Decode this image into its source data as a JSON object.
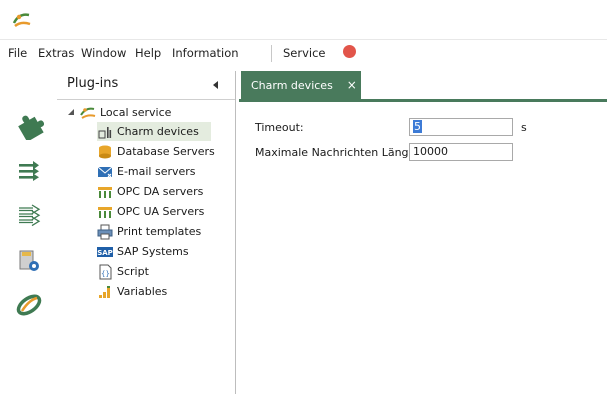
{
  "menubar": {
    "items": [
      "File",
      "Extras",
      "Window",
      "Help",
      "Information",
      "Service"
    ]
  },
  "status_color": "#e2554a",
  "accent_color": "#497a5c",
  "activity_bar": {
    "icons": [
      "puzzle-icon",
      "arrows-solid-icon",
      "arrows-outline-icon",
      "document-settings-icon",
      "orbit-logo-icon"
    ]
  },
  "plugins_panel": {
    "title": "Plug-ins",
    "root_label": "Local service",
    "items": [
      {
        "label": "Charm devices",
        "icon": "charm-device-icon",
        "selected": true
      },
      {
        "label": "Database Servers",
        "icon": "database-icon",
        "selected": false
      },
      {
        "label": "E-mail servers",
        "icon": "email-server-icon",
        "selected": false
      },
      {
        "label": "OPC DA servers",
        "icon": "opc-da-icon",
        "selected": false
      },
      {
        "label": "OPC UA Servers",
        "icon": "opc-ua-icon",
        "selected": false
      },
      {
        "label": "Print templates",
        "icon": "printer-icon",
        "selected": false
      },
      {
        "label": "SAP Systems",
        "icon": "sap-icon",
        "selected": false
      },
      {
        "label": "Script",
        "icon": "script-icon",
        "selected": false
      },
      {
        "label": "Variables",
        "icon": "variables-icon",
        "selected": false
      }
    ]
  },
  "document_tab": {
    "label": "Charm devices",
    "close_label": "×"
  },
  "form": {
    "timeout_label": "Timeout:",
    "timeout_value": "5",
    "timeout_unit": "s",
    "max_length_label": "Maximale Nachrichten Länge:",
    "max_length_value": "10000"
  }
}
